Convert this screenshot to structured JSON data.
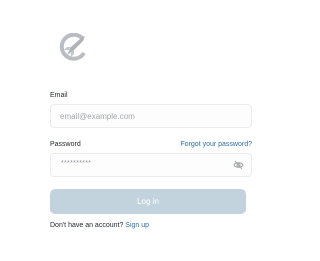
{
  "app": {
    "logo_icon": "rocket-circle-icon",
    "accent_color": "#2f6fa8",
    "button_color": "#c3d3de"
  },
  "form": {
    "email_label": "Email",
    "email_placeholder": "email@example.com",
    "password_label": "Password",
    "forgot_password_link": "Forgot your password?",
    "password_value": "**********",
    "password_toggle_icon": "eye-off-icon",
    "login_button": "Log in",
    "signup_prompt": "Don't have an account?",
    "signup_link": "Sign up"
  }
}
